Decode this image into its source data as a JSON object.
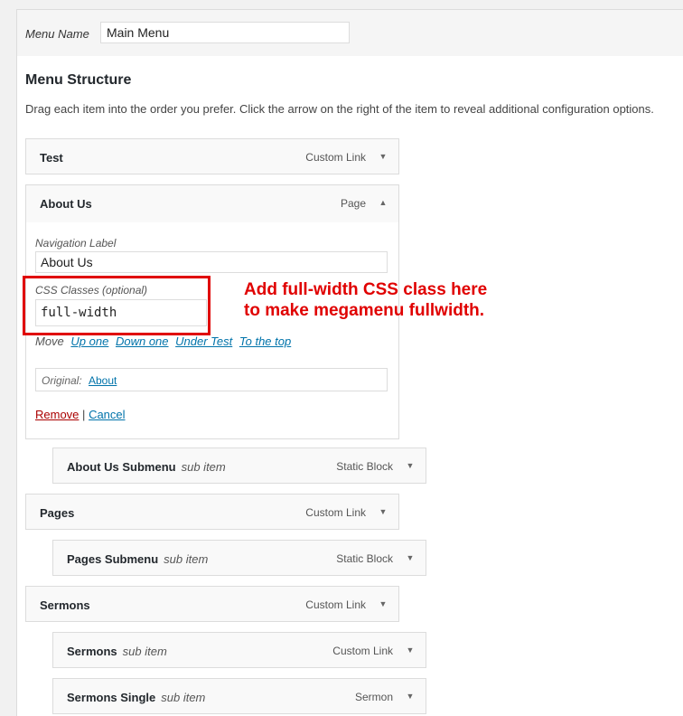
{
  "menu_name": {
    "label": "Menu Name",
    "value": "Main Menu"
  },
  "structure": {
    "title": "Menu Structure",
    "description": "Drag each item into the order you prefer. Click the arrow on the right of the item to reveal additional configuration options."
  },
  "items": [
    {
      "title": "Test",
      "sub": "",
      "type": "Custom Link",
      "arrow": "▼"
    },
    {
      "title": "About Us",
      "sub": "",
      "type": "Page",
      "arrow": "▲"
    },
    {
      "title": "About Us Submenu",
      "sub": "sub item",
      "type": "Static Block",
      "arrow": "▼"
    },
    {
      "title": "Pages",
      "sub": "",
      "type": "Custom Link",
      "arrow": "▼"
    },
    {
      "title": "Pages Submenu",
      "sub": "sub item",
      "type": "Static Block",
      "arrow": "▼"
    },
    {
      "title": "Sermons",
      "sub": "",
      "type": "Custom Link",
      "arrow": "▼"
    },
    {
      "title": "Sermons",
      "sub": "sub item",
      "type": "Custom Link",
      "arrow": "▼"
    },
    {
      "title": "Sermons Single",
      "sub": "sub item",
      "type": "Sermon",
      "arrow": "▼"
    }
  ],
  "settings": {
    "nav_label_label": "Navigation Label",
    "nav_label_value": "About Us",
    "css_label": "CSS Classes (optional)",
    "css_value": "full-width",
    "move_label": "Move",
    "move_links": [
      "Up one",
      "Down one",
      "Under Test",
      "To the top"
    ],
    "original_label": "Original:",
    "original_link": "About",
    "remove": "Remove",
    "separator": "|",
    "cancel": "Cancel"
  },
  "annotation": {
    "line1": "Add full-width CSS class here",
    "line2": "to make megamenu fullwidth."
  },
  "colors": {
    "highlight": "#e00000",
    "link": "#0073aa",
    "remove": "#aa0000"
  }
}
